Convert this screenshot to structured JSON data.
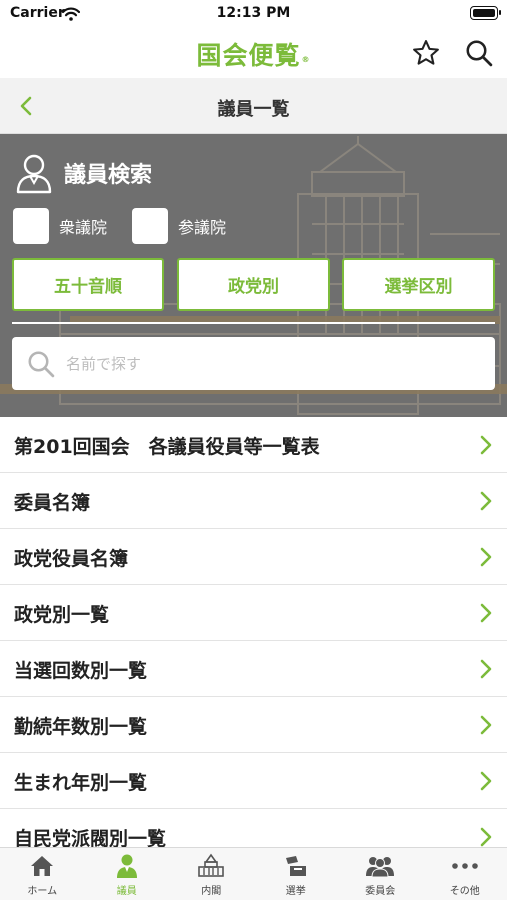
{
  "status_bar": {
    "carrier": "Carrier",
    "time": "12:13 PM"
  },
  "header": {
    "app_title": "国会便覧",
    "registered_mark": "®"
  },
  "nav": {
    "title": "議員一覧"
  },
  "search_panel": {
    "title": "議員検索",
    "chambers": [
      {
        "label": "衆議院"
      },
      {
        "label": "参議院"
      }
    ],
    "sort_buttons": [
      {
        "label": "五十音順"
      },
      {
        "label": "政党別"
      },
      {
        "label": "選挙区別"
      }
    ],
    "name_search": {
      "placeholder": "名前で探す",
      "value": ""
    }
  },
  "list": {
    "items": [
      {
        "label": "第201回国会　各議員役員等一覧表"
      },
      {
        "label": "委員名簿"
      },
      {
        "label": "政党役員名簿"
      },
      {
        "label": "政党別一覧"
      },
      {
        "label": "当選回数別一覧"
      },
      {
        "label": "勤続年数別一覧"
      },
      {
        "label": "生まれ年別一覧"
      },
      {
        "label": "自民党派閥別一覧"
      }
    ]
  },
  "tabbar": {
    "tabs": [
      {
        "label": "ホーム",
        "icon": "home-icon"
      },
      {
        "label": "議員",
        "icon": "member-icon",
        "active": true
      },
      {
        "label": "内閣",
        "icon": "diet-building-icon"
      },
      {
        "label": "選挙",
        "icon": "ballot-box-icon"
      },
      {
        "label": "委員会",
        "icon": "committee-icon"
      },
      {
        "label": "その他",
        "icon": "more-icon"
      }
    ]
  },
  "colors": {
    "accent": "#7cbb3a",
    "panel": "#6f6f6f",
    "nav_bg": "#f2f2f2"
  }
}
